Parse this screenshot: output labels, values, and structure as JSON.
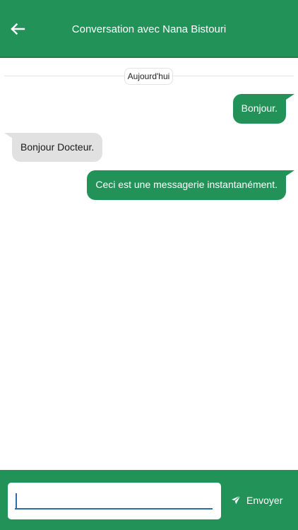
{
  "header": {
    "back_icon": "arrow-left-icon",
    "title": "Conversation avec Nana Bistouri"
  },
  "conversation": {
    "date_label": "Aujourd'hui",
    "messages": [
      {
        "direction": "outgoing",
        "text": "Bonjour."
      },
      {
        "direction": "incoming",
        "text": "Bonjour Docteur."
      },
      {
        "direction": "outgoing",
        "text": "Ceci est une messagerie instantanément."
      }
    ]
  },
  "composer": {
    "input_value": "",
    "input_placeholder": "",
    "send_icon": "paper-plane-icon",
    "send_label": "Envoyer"
  },
  "colors": {
    "primary": "#239259",
    "incoming_bubble": "#e1e1e1",
    "input_underline": "#2d6ea8"
  }
}
